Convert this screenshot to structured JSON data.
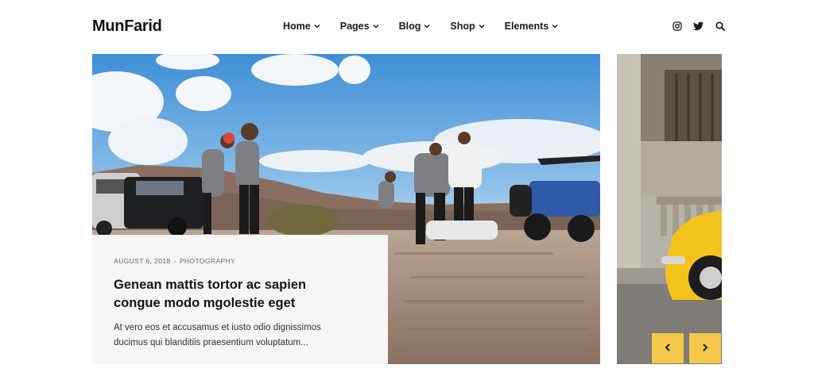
{
  "brand": {
    "name": "MunFarid"
  },
  "nav": {
    "items": [
      {
        "label": "Home"
      },
      {
        "label": "Pages"
      },
      {
        "label": "Blog"
      },
      {
        "label": "Shop"
      },
      {
        "label": "Elements"
      }
    ]
  },
  "header_icons": [
    "instagram-icon",
    "twitter-icon",
    "search-icon"
  ],
  "featured_post": {
    "date": "AUGUST 6, 2018",
    "separator": "-",
    "category": "PHOTOGRAPHY",
    "title": "Genean mattis tortor ac sapien congue modo mgolestie eget",
    "excerpt": "At vero eos et accusamus et iusto odio dignissimos ducimus qui blanditiis praesentium voluptatum..."
  },
  "slider": {
    "prev_icon": "chevron-left-icon",
    "next_icon": "chevron-right-icon"
  },
  "colors": {
    "accent": "#f5c94a",
    "card_bg": "#f7f6f4",
    "text": "#141414"
  }
}
